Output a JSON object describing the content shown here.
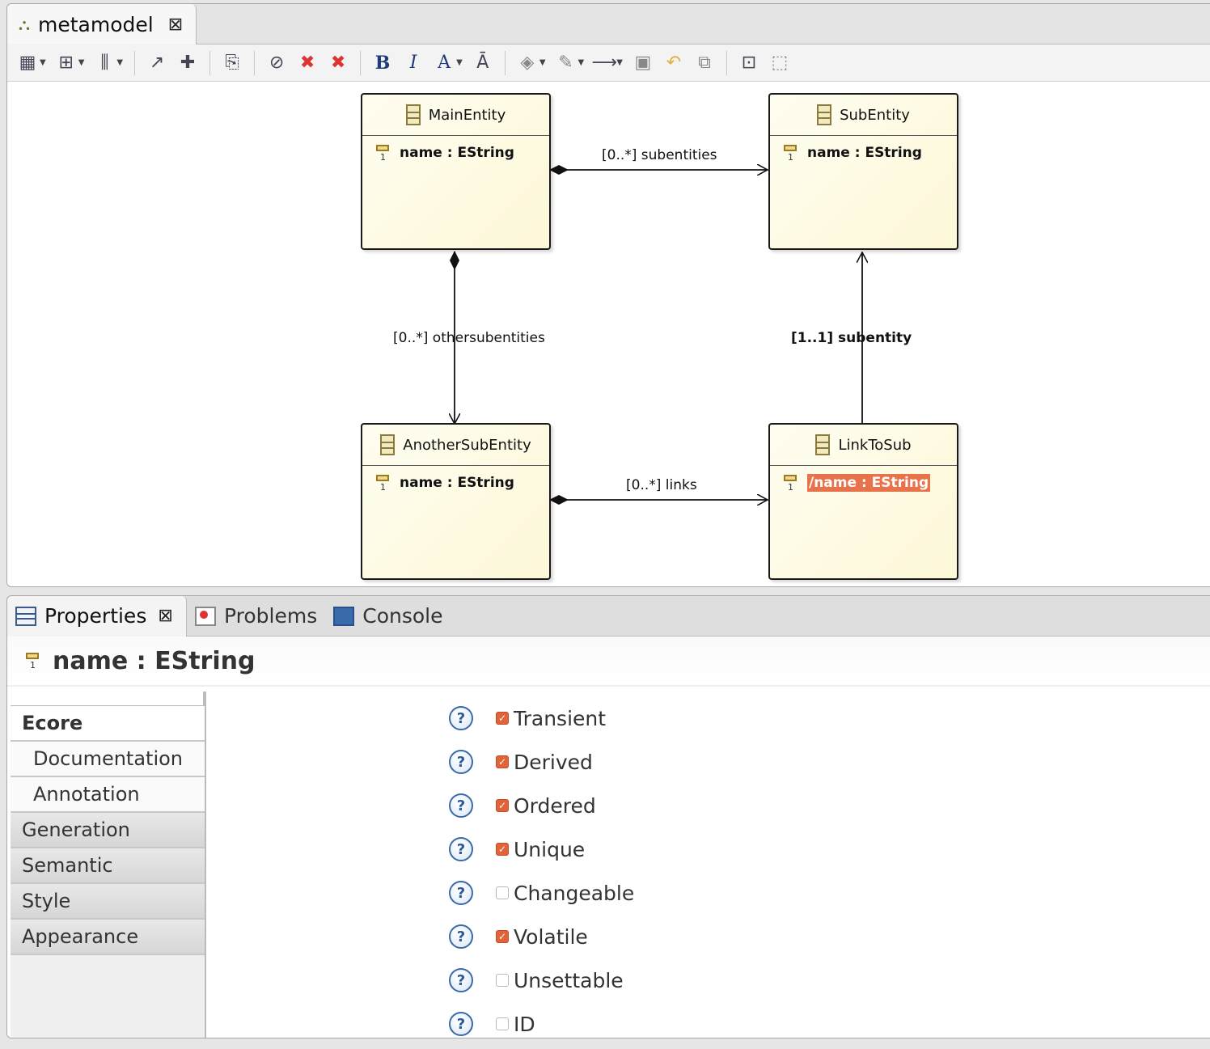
{
  "editor": {
    "tab_title": "metamodel",
    "close_symbol": "⊠"
  },
  "toolbar": {
    "bold": "B",
    "italic": "I",
    "font_color": "A"
  },
  "diagram": {
    "entities": [
      {
        "id": "main",
        "name": "MainEntity",
        "attr": "name : EString"
      },
      {
        "id": "sub",
        "name": "SubEntity",
        "attr": "name : EString"
      },
      {
        "id": "another",
        "name": "AnotherSubEntity",
        "attr": "name : EString"
      },
      {
        "id": "link",
        "name": "LinkToSub",
        "attr": "/name : EString"
      }
    ],
    "edges": {
      "subentities": "[0..*] subentities",
      "othersubentities": "[0..*] othersubentities",
      "subentity": "[1..1] subentity",
      "links": "[0..*] links"
    },
    "attr_multiplicity": "1"
  },
  "properties": {
    "tabs": {
      "properties": "Properties",
      "problems": "Problems",
      "console": "Console"
    },
    "title": "name : EString",
    "sidebar": [
      "Ecore",
      "Documentation",
      "Annotation",
      "Generation",
      "Semantic",
      "Style",
      "Appearance"
    ],
    "checkboxes": [
      {
        "label": "Transient",
        "checked": true
      },
      {
        "label": "Derived",
        "checked": true
      },
      {
        "label": "Ordered",
        "checked": true
      },
      {
        "label": "Unique",
        "checked": true
      },
      {
        "label": "Changeable",
        "checked": false
      },
      {
        "label": "Volatile",
        "checked": true
      },
      {
        "label": "Unsettable",
        "checked": false
      },
      {
        "label": "ID",
        "checked": false
      }
    ],
    "help_symbol": "?"
  },
  "colors": {
    "accent": "#e0633a",
    "entity_fill": "#fdf8d8",
    "highlight": "#e8734a"
  }
}
